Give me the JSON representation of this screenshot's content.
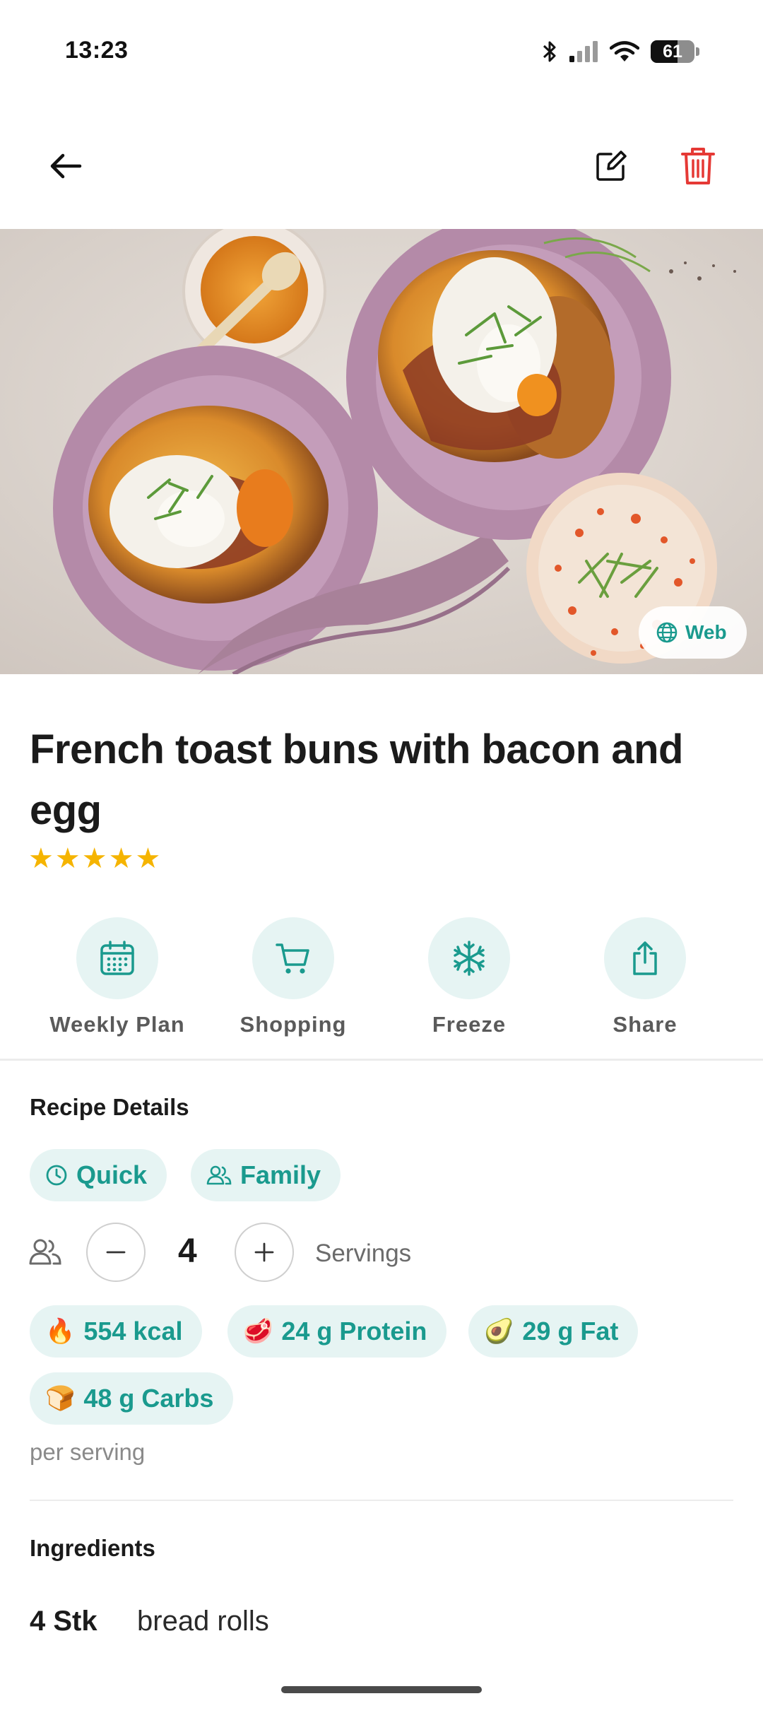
{
  "status_bar": {
    "time": "13:23",
    "battery": "61",
    "battery_level": 0.61
  },
  "recipe": {
    "title": "French toast buns with bacon and egg",
    "rating": 5,
    "rating_stars": "★★★★★",
    "source_badge": "Web"
  },
  "actions": [
    {
      "label": "Weekly Plan",
      "icon": "calendar-icon"
    },
    {
      "label": "Shopping",
      "icon": "cart-icon"
    },
    {
      "label": "Freeze",
      "icon": "snowflake-icon"
    },
    {
      "label": "Share",
      "icon": "share-icon"
    }
  ],
  "details": {
    "heading": "Recipe Details",
    "tags": [
      {
        "label": "Quick",
        "icon": "clock-icon"
      },
      {
        "label": "Family",
        "icon": "people-icon"
      }
    ],
    "servings": {
      "count": "4",
      "label": "Servings"
    },
    "nutrition": [
      {
        "emoji": "🔥",
        "label": "554 kcal"
      },
      {
        "emoji": "🥩",
        "label": "24 g Protein"
      },
      {
        "emoji": "🥑",
        "label": "29 g Fat"
      },
      {
        "emoji": "🍞",
        "label": "48 g Carbs"
      }
    ],
    "per_serving": "per serving"
  },
  "ingredients": {
    "heading": "Ingredients",
    "items": [
      {
        "qty": "4 Stk",
        "name": "bread rolls"
      }
    ]
  },
  "colors": {
    "accent": "#1a9a8e",
    "accent_bg": "#e6f4f3",
    "delete": "#e53935",
    "stars": "#f5b400"
  }
}
